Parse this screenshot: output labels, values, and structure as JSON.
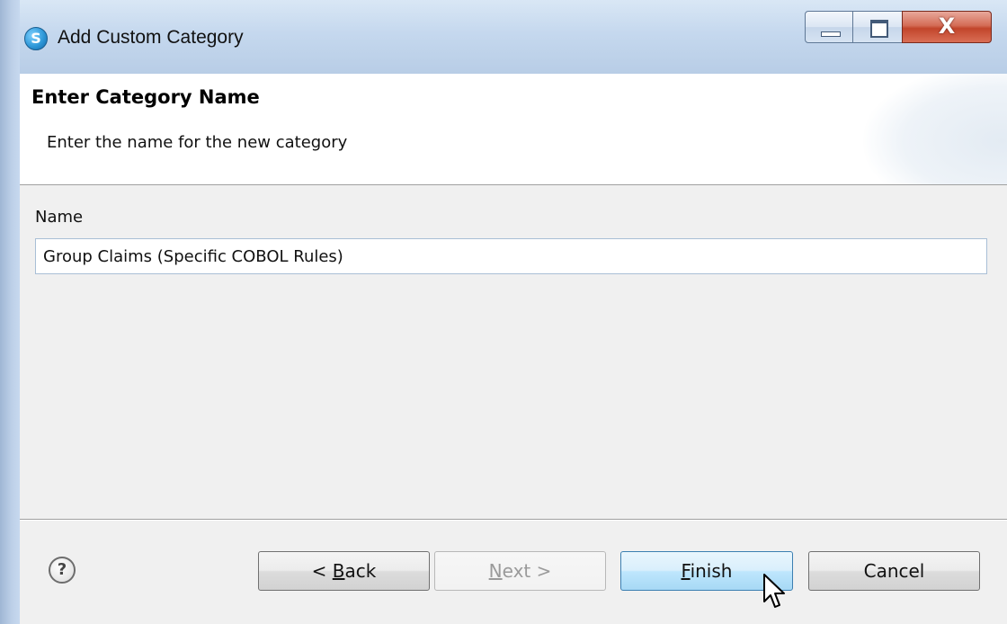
{
  "window": {
    "title": "Add Custom Category",
    "icon": "app-logo-icon",
    "controls": {
      "minimize": "minimize-icon",
      "maximize": "maximize-icon",
      "close": "X"
    }
  },
  "banner": {
    "title": "Enter Category Name",
    "description": "Enter the name for the new category"
  },
  "form": {
    "name_label": "Name",
    "name_value": "Group Claims (Specific COBOL Rules)"
  },
  "footer": {
    "help_glyph": "?",
    "back": {
      "prefix": "< ",
      "mnemonic": "B",
      "rest": "ack"
    },
    "next": {
      "mnemonic": "N",
      "rest": "ext >"
    },
    "finish": {
      "mnemonic": "F",
      "rest": "inish"
    },
    "cancel": "Cancel"
  }
}
